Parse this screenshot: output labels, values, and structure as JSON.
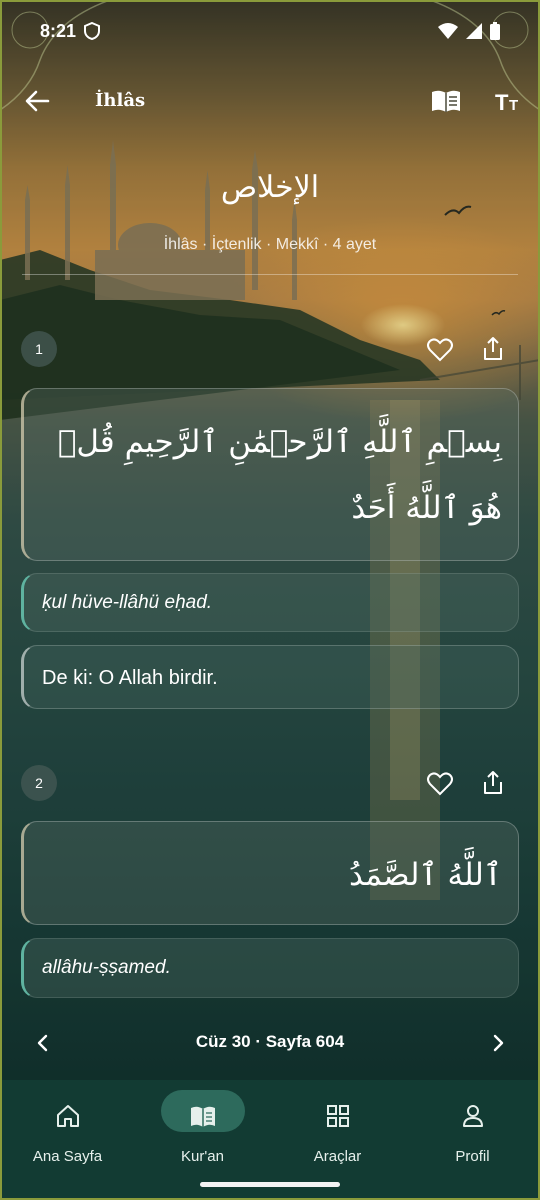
{
  "status_bar": {
    "time": "8:21"
  },
  "app_bar": {
    "title": "İhlâs"
  },
  "surah": {
    "arabic_name": "الإخلاص",
    "meta": "İhlâs · İçtenlik · Mekkî · 4 ayet"
  },
  "verses": [
    {
      "number": "1",
      "arabic": "بِسۡمِ ٱللَّهِ ٱلرَّحۡمَٰنِ ٱلرَّحِيمِ قُلۡ هُوَ ٱللَّهُ أَحَدٌ",
      "transliteration": "ḳul hüve-llâhü eḥad.",
      "translation": "De ki: O Allah birdir."
    },
    {
      "number": "2",
      "arabic": "ٱللَّهُ ٱلصَّمَدُ",
      "transliteration": "allâhu-ṣṣamed."
    }
  ],
  "pager": {
    "label": "Cüz 30 · Sayfa 604"
  },
  "bottom_nav": {
    "tabs": [
      {
        "label": "Ana Sayfa",
        "icon": "home-icon"
      },
      {
        "label": "Kur'an",
        "icon": "book-icon",
        "active": true
      },
      {
        "label": "Araçlar",
        "icon": "grid-icon"
      },
      {
        "label": "Profil",
        "icon": "person-icon"
      }
    ]
  },
  "colors": {
    "nav_background": "#123b33",
    "active_pill": "#2d6a5c",
    "translit_accent": "#5fb3a0"
  }
}
